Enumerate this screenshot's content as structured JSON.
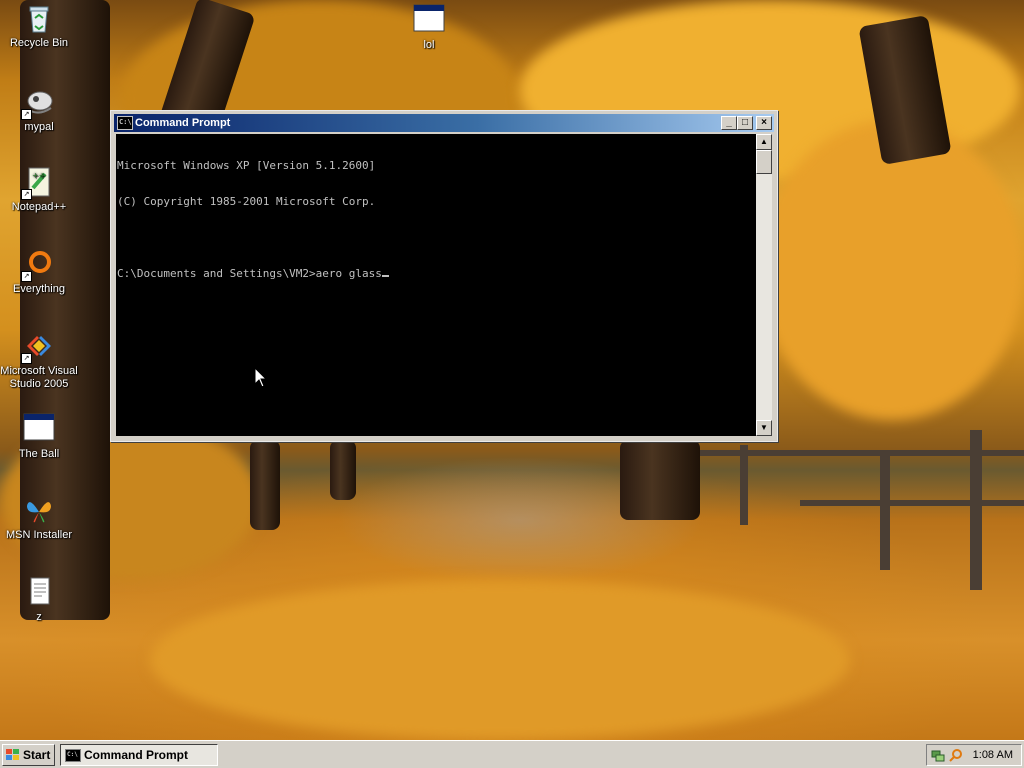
{
  "desktop": {
    "icons": [
      {
        "label": "Recycle Bin",
        "icon": "recycle-bin-icon"
      },
      {
        "label": "lol",
        "icon": "window-app-icon"
      },
      {
        "label": "mypal",
        "icon": "mypal-browser-icon"
      },
      {
        "label": "Notepad++",
        "icon": "notepad-plus-plus-icon"
      },
      {
        "label": "Everything",
        "icon": "everything-search-icon"
      },
      {
        "label": "Microsoft Visual Studio 2005",
        "icon": "visual-studio-icon"
      },
      {
        "label": "The Ball",
        "icon": "window-app-icon"
      },
      {
        "label": "MSN Installer",
        "icon": "msn-butterfly-icon"
      },
      {
        "label": "z",
        "icon": "text-document-icon"
      }
    ]
  },
  "window": {
    "title": "Command Prompt",
    "icon_text": "C:\\",
    "controls": {
      "minimize": "_",
      "maximize": "□",
      "close": "×"
    },
    "console_lines": [
      "Microsoft Windows XP [Version 5.1.2600]",
      "(C) Copyright 1985-2001 Microsoft Corp.",
      "",
      "C:\\Documents and Settings\\VM2>aero glass"
    ],
    "scroll_up": "▲",
    "scroll_down": "▼"
  },
  "taskbar": {
    "start_label": "Start",
    "tasks": [
      {
        "label": "Command Prompt",
        "icon_text": "C:\\"
      }
    ],
    "tray": {
      "clock": "1:08 AM",
      "icons": [
        "network-icon",
        "search-tray-icon"
      ]
    }
  }
}
